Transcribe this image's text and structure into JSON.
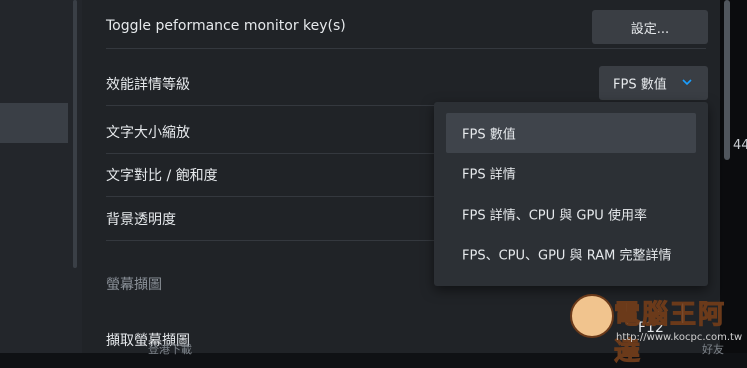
{
  "settings": {
    "toggle_perf_key_label": "Toggle peformance monitor key(s)",
    "settings_button": "設定...",
    "detail_level_label": "效能詳情等級",
    "detail_level_value": "FPS 數值",
    "text_scale_label": "文字大小縮放",
    "contrast_label": "文字對比 / 飽和度",
    "bg_opacity_label": "背景透明度",
    "screenshot_section": "螢幕擷圖",
    "capture_label": "擷取螢幕擷圖",
    "capture_key": "F12"
  },
  "dropdown": {
    "options": [
      "FPS 數值",
      "FPS 詳情",
      "FPS 詳情、CPU 與 GPU 使用率",
      "FPS、CPU、GPU 與 RAM 完整詳情"
    ],
    "selected": "FPS 數值"
  },
  "edge": {
    "right_fragment": "44"
  },
  "taskbar": {
    "left_text": "登港下載",
    "right_text": "好友"
  },
  "watermark": {
    "text": "電腦王阿達",
    "url": "http://www.kocpc.com.tw"
  },
  "colors": {
    "accent": "#1a9fff",
    "panel": "#202327",
    "dropdown": "#2c3035"
  }
}
